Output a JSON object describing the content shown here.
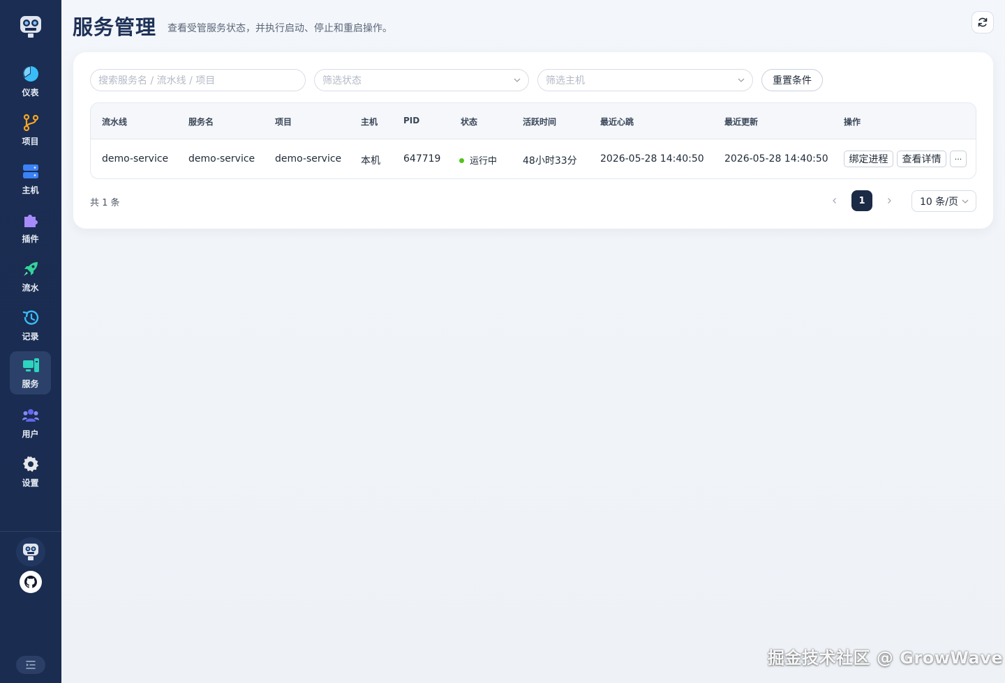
{
  "header": {
    "title": "服务管理",
    "subtitle": "查看受管服务状态，并执行启动、停止和重启操作。"
  },
  "sidebar": {
    "items": [
      {
        "label": "仪表",
        "icon": "pie-chart-icon",
        "color": "#38bdf8"
      },
      {
        "label": "项目",
        "icon": "git-branch-icon",
        "color": "#f5a623"
      },
      {
        "label": "主机",
        "icon": "server-icon",
        "color": "#3b82f6"
      },
      {
        "label": "插件",
        "icon": "puzzle-icon",
        "color": "#a78bfa"
      },
      {
        "label": "流水",
        "icon": "rocket-icon",
        "color": "#34d399"
      },
      {
        "label": "记录",
        "icon": "history-icon",
        "color": "#38bdf8"
      },
      {
        "label": "服务",
        "icon": "service-icon",
        "color": "#2dd4bf",
        "active": true
      },
      {
        "label": "用户",
        "icon": "users-icon",
        "color": "#6366f1"
      },
      {
        "label": "设置",
        "icon": "gear-icon",
        "color": "#e5e7eb"
      }
    ]
  },
  "filters": {
    "search_placeholder": "搜索服务名 / 流水线 / 项目",
    "status_placeholder": "筛选状态",
    "host_placeholder": "筛选主机",
    "reset_label": "重置条件"
  },
  "table": {
    "headers": [
      "流水线",
      "服务名",
      "项目",
      "主机",
      "PID",
      "状态",
      "活跃时间",
      "最近心跳",
      "最近更新",
      "操作"
    ],
    "rows": [
      {
        "pipeline": "demo-service",
        "service": "demo-service",
        "project": "demo-service",
        "host": "本机",
        "pid": "647719",
        "status": "运行中",
        "uptime": "48小时33分",
        "heartbeat": "2026-05-28 14:40:50",
        "updated": "2026-05-28 14:40:50",
        "actions": {
          "bind": "绑定进程",
          "detail": "查看详情",
          "more": "···"
        }
      }
    ]
  },
  "pagination": {
    "total": "共 1 条",
    "current": "1",
    "page_size": "10 条/页"
  },
  "watermark": "掘金技术社区 @ GrowWave"
}
